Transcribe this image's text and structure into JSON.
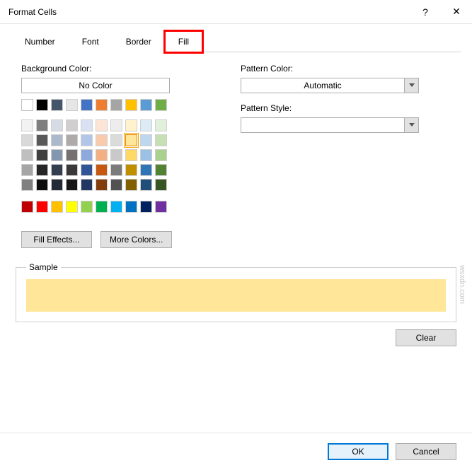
{
  "window": {
    "title": "Format Cells",
    "help_icon": "?",
    "close_icon": "✕"
  },
  "tabs": {
    "number": "Number",
    "font": "Font",
    "border": "Border",
    "fill": "Fill"
  },
  "labels": {
    "background_color": "Background Color:",
    "no_color": "No Color",
    "fill_effects": "Fill Effects...",
    "more_colors": "More Colors...",
    "pattern_color": "Pattern Color:",
    "pattern_style": "Pattern Style:",
    "automatic": "Automatic",
    "sample_legend": "Sample",
    "clear": "Clear",
    "ok": "OK",
    "cancel": "Cancel"
  },
  "colors": {
    "theme_row1": [
      "#FFFFFF",
      "#000000",
      "#44546A",
      "#E7E6E6",
      "#4472C4",
      "#ED7D31",
      "#A5A5A5",
      "#FFC000",
      "#5B9BD5",
      "#70AD47"
    ],
    "theme_rows": [
      [
        "#F2F2F2",
        "#7F7F7F",
        "#D6DCE4",
        "#D0CECE",
        "#D9E1F2",
        "#FCE4D6",
        "#EDEDED",
        "#FFF2CC",
        "#DDEBF7",
        "#E2EFDA"
      ],
      [
        "#D9D9D9",
        "#595959",
        "#ACB9CA",
        "#AEAAAA",
        "#B4C6E7",
        "#F8CBAD",
        "#DBDBDB",
        "#FFE699",
        "#BDD7EE",
        "#C6E0B4"
      ],
      [
        "#BFBFBF",
        "#404040",
        "#8497B0",
        "#757171",
        "#8EA9DB",
        "#F4B084",
        "#C9C9C9",
        "#FFD966",
        "#9BC2E6",
        "#A9D08E"
      ],
      [
        "#A6A6A6",
        "#262626",
        "#333F4F",
        "#3A3838",
        "#305496",
        "#C65911",
        "#7B7B7B",
        "#BF8F00",
        "#2F75B5",
        "#548235"
      ],
      [
        "#808080",
        "#0D0D0D",
        "#222B35",
        "#161616",
        "#203764",
        "#833C0C",
        "#525252",
        "#806000",
        "#1F4E78",
        "#375623"
      ]
    ],
    "standard": [
      "#C00000",
      "#FF0000",
      "#FFC000",
      "#FFFF00",
      "#92D050",
      "#00B050",
      "#00B0F0",
      "#0070C0",
      "#002060",
      "#7030A0"
    ],
    "selected": "#FFE699",
    "sample": "#FFE699"
  },
  "watermark": "wsxdn.com"
}
